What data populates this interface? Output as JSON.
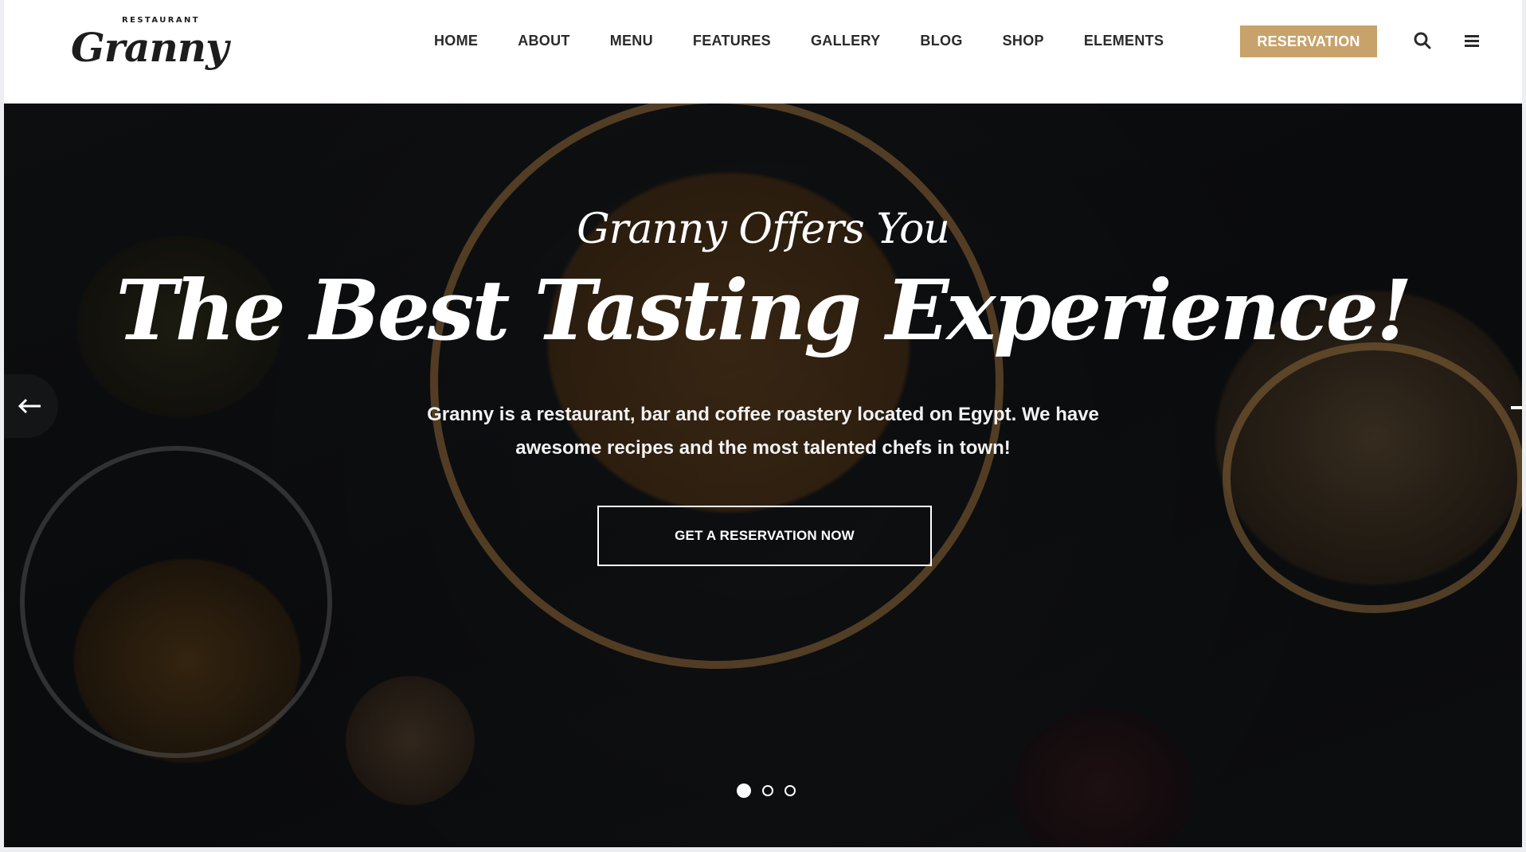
{
  "brand": {
    "small_label": "RESTAURANT",
    "name": "Granny"
  },
  "nav": {
    "items": [
      {
        "label": "HOME",
        "active": true
      },
      {
        "label": "ABOUT"
      },
      {
        "label": "MENU"
      },
      {
        "label": "FEATURES"
      },
      {
        "label": "GALLERY"
      },
      {
        "label": "BLOG"
      },
      {
        "label": "SHOP"
      },
      {
        "label": "ELEMENTS"
      }
    ],
    "reservation_label": "RESERVATION",
    "icons": [
      "search-icon",
      "hamburger-menu-icon"
    ]
  },
  "hero": {
    "subtitle": "Granny Offers You",
    "headline": "The Best Tasting Experience!",
    "description_line1": "Granny is a restaurant, bar and coffee roastery located on Egypt. We have",
    "description_line2": "awesome recipes and the most talented chefs in town!",
    "cta_label": "GET A RESERVATION NOW",
    "slides": {
      "count": 3,
      "active": 1
    }
  },
  "colors": {
    "accent": "#c7a26b",
    "text_dark": "#2a2a2a",
    "hero_text": "#ffffff"
  }
}
